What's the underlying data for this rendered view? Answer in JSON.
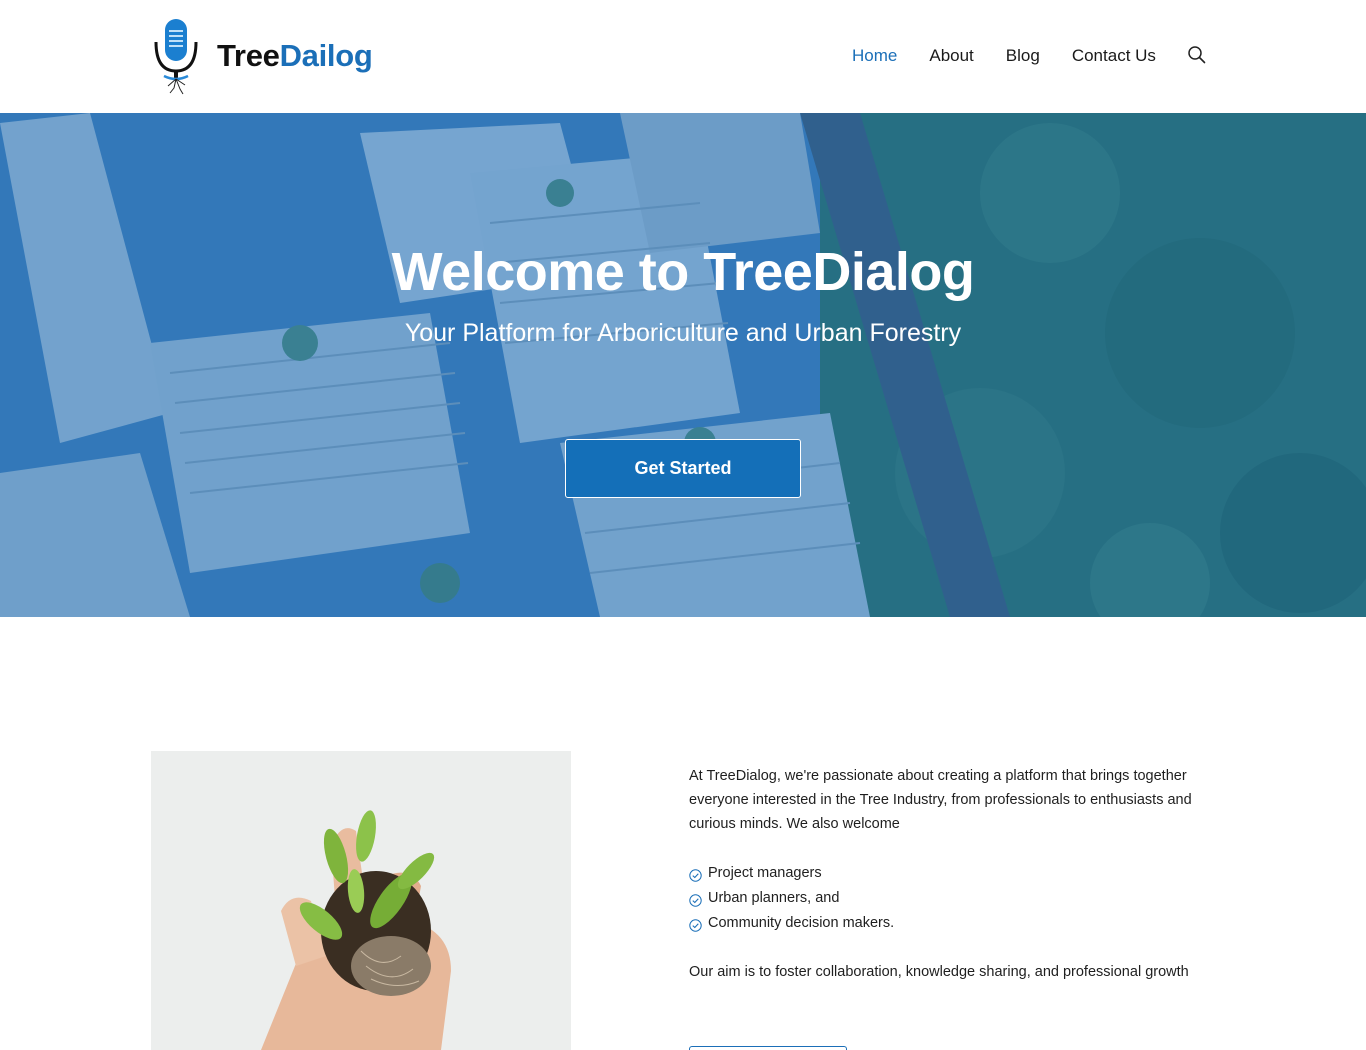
{
  "header": {
    "brand_part1": "Tree",
    "brand_part2": "Dailog",
    "nav": [
      {
        "label": "Home",
        "active": true
      },
      {
        "label": "About",
        "active": false
      },
      {
        "label": "Blog",
        "active": false
      },
      {
        "label": "Contact Us",
        "active": false
      }
    ],
    "search_icon": "search-icon"
  },
  "hero": {
    "title": "Welcome to TreeDialog",
    "subtitle": "Your Platform for Arboriculture and Urban Forestry",
    "cta_label": "Get Started"
  },
  "about": {
    "intro": "At TreeDialog, we're passionate about creating a platform that brings together everyone interested in the Tree Industry, from professionals to enthusiasts and curious minds. We also welcome",
    "audience": [
      "Project managers",
      "Urban planners, and",
      "Community decision makers."
    ],
    "aim": "Our aim is to foster collaboration, knowledge sharing, and professional growth",
    "check_icon": "check-circle-icon"
  },
  "colors": {
    "accent": "#1b6fb8",
    "hero_overlay": "#1266b2",
    "text": "#1f1f1f"
  }
}
